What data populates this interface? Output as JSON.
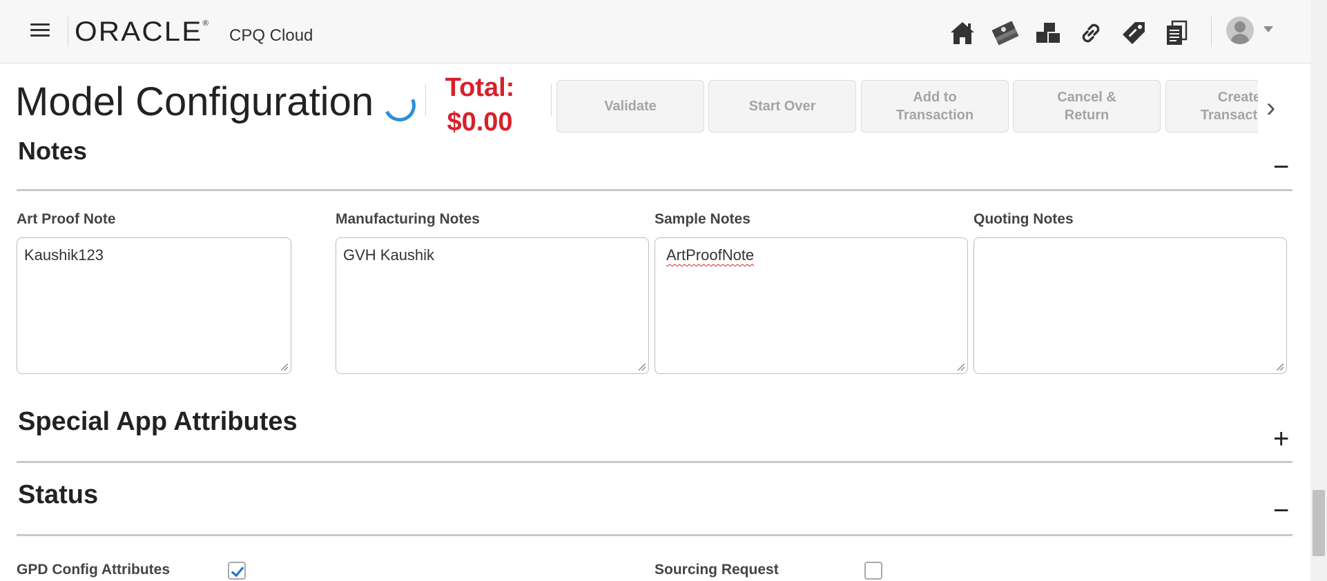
{
  "header": {
    "brand": "ORACLE",
    "brand_mark": "®",
    "product": "CPQ Cloud",
    "icons": [
      "home-icon",
      "money-icon",
      "parts-icon",
      "link-icon",
      "tag-icon",
      "documents-icon"
    ]
  },
  "title_bar": {
    "title": "Model Configuration",
    "total_label": "Total:",
    "total_value": "$0.00",
    "total_color": "#d8202b",
    "actions": [
      {
        "label": "Validate"
      },
      {
        "label": "Start Over"
      },
      {
        "label": "Add to Transaction"
      },
      {
        "label": "Cancel & Return"
      },
      {
        "label": "Create Transaction"
      }
    ]
  },
  "sections": {
    "notes": {
      "title": "Notes",
      "toggle": "−",
      "fields": [
        {
          "label": "Art Proof Note",
          "value": "Kaushik123"
        },
        {
          "label": "Manufacturing Notes",
          "value": "GVH Kaushik"
        },
        {
          "label": "Sample Notes",
          "value": "ArtProofNote"
        },
        {
          "label": "Quoting Notes",
          "value": ""
        }
      ]
    },
    "special": {
      "title": "Special App Attributes",
      "toggle": "+"
    },
    "status": {
      "title": "Status",
      "toggle": "−",
      "fields": [
        {
          "label": "GPD Config Attributes",
          "checked": true
        },
        {
          "label": "Sourcing Request",
          "checked": false
        }
      ]
    }
  }
}
